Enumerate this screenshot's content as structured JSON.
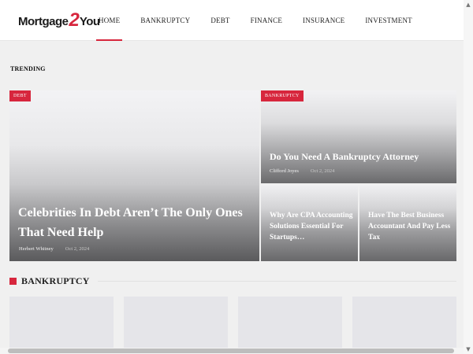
{
  "logo": {
    "part1": "Mortgage",
    "part2": "2",
    "part3": "You"
  },
  "nav": {
    "items": [
      {
        "label": "HOME"
      },
      {
        "label": "BANKRUPTCY"
      },
      {
        "label": "DEBT"
      },
      {
        "label": "FINANCE"
      },
      {
        "label": "INSURANCE"
      },
      {
        "label": "INVESTMENT"
      }
    ],
    "active": "HOME"
  },
  "trending": {
    "label": "TRENDING",
    "main": {
      "tag": "DEBT",
      "title": "Celebrities In Debt Aren’t The Only Ones That Need Help",
      "author": "Herbert Whitney",
      "date": "Oct 2, 2024"
    },
    "top": {
      "tag": "BANKRUPTCY",
      "title": "Do You Need A Bankruptcy Attorney",
      "author": "Clifford Joyes",
      "date": "Oct 2, 2024"
    },
    "small": [
      {
        "title": "Why Are CPA Accounting Solutions Essential For Startups…"
      },
      {
        "title": "Have The Best Business Accountant And Pay Less Tax"
      }
    ]
  },
  "section": {
    "title": "BANKRUPTCY"
  },
  "scrollbar": {
    "up": "▲",
    "down": "▼"
  },
  "colors": {
    "accent": "#d7263d",
    "header_bg": "#ffffff",
    "page_bg": "#f0f0f0"
  }
}
